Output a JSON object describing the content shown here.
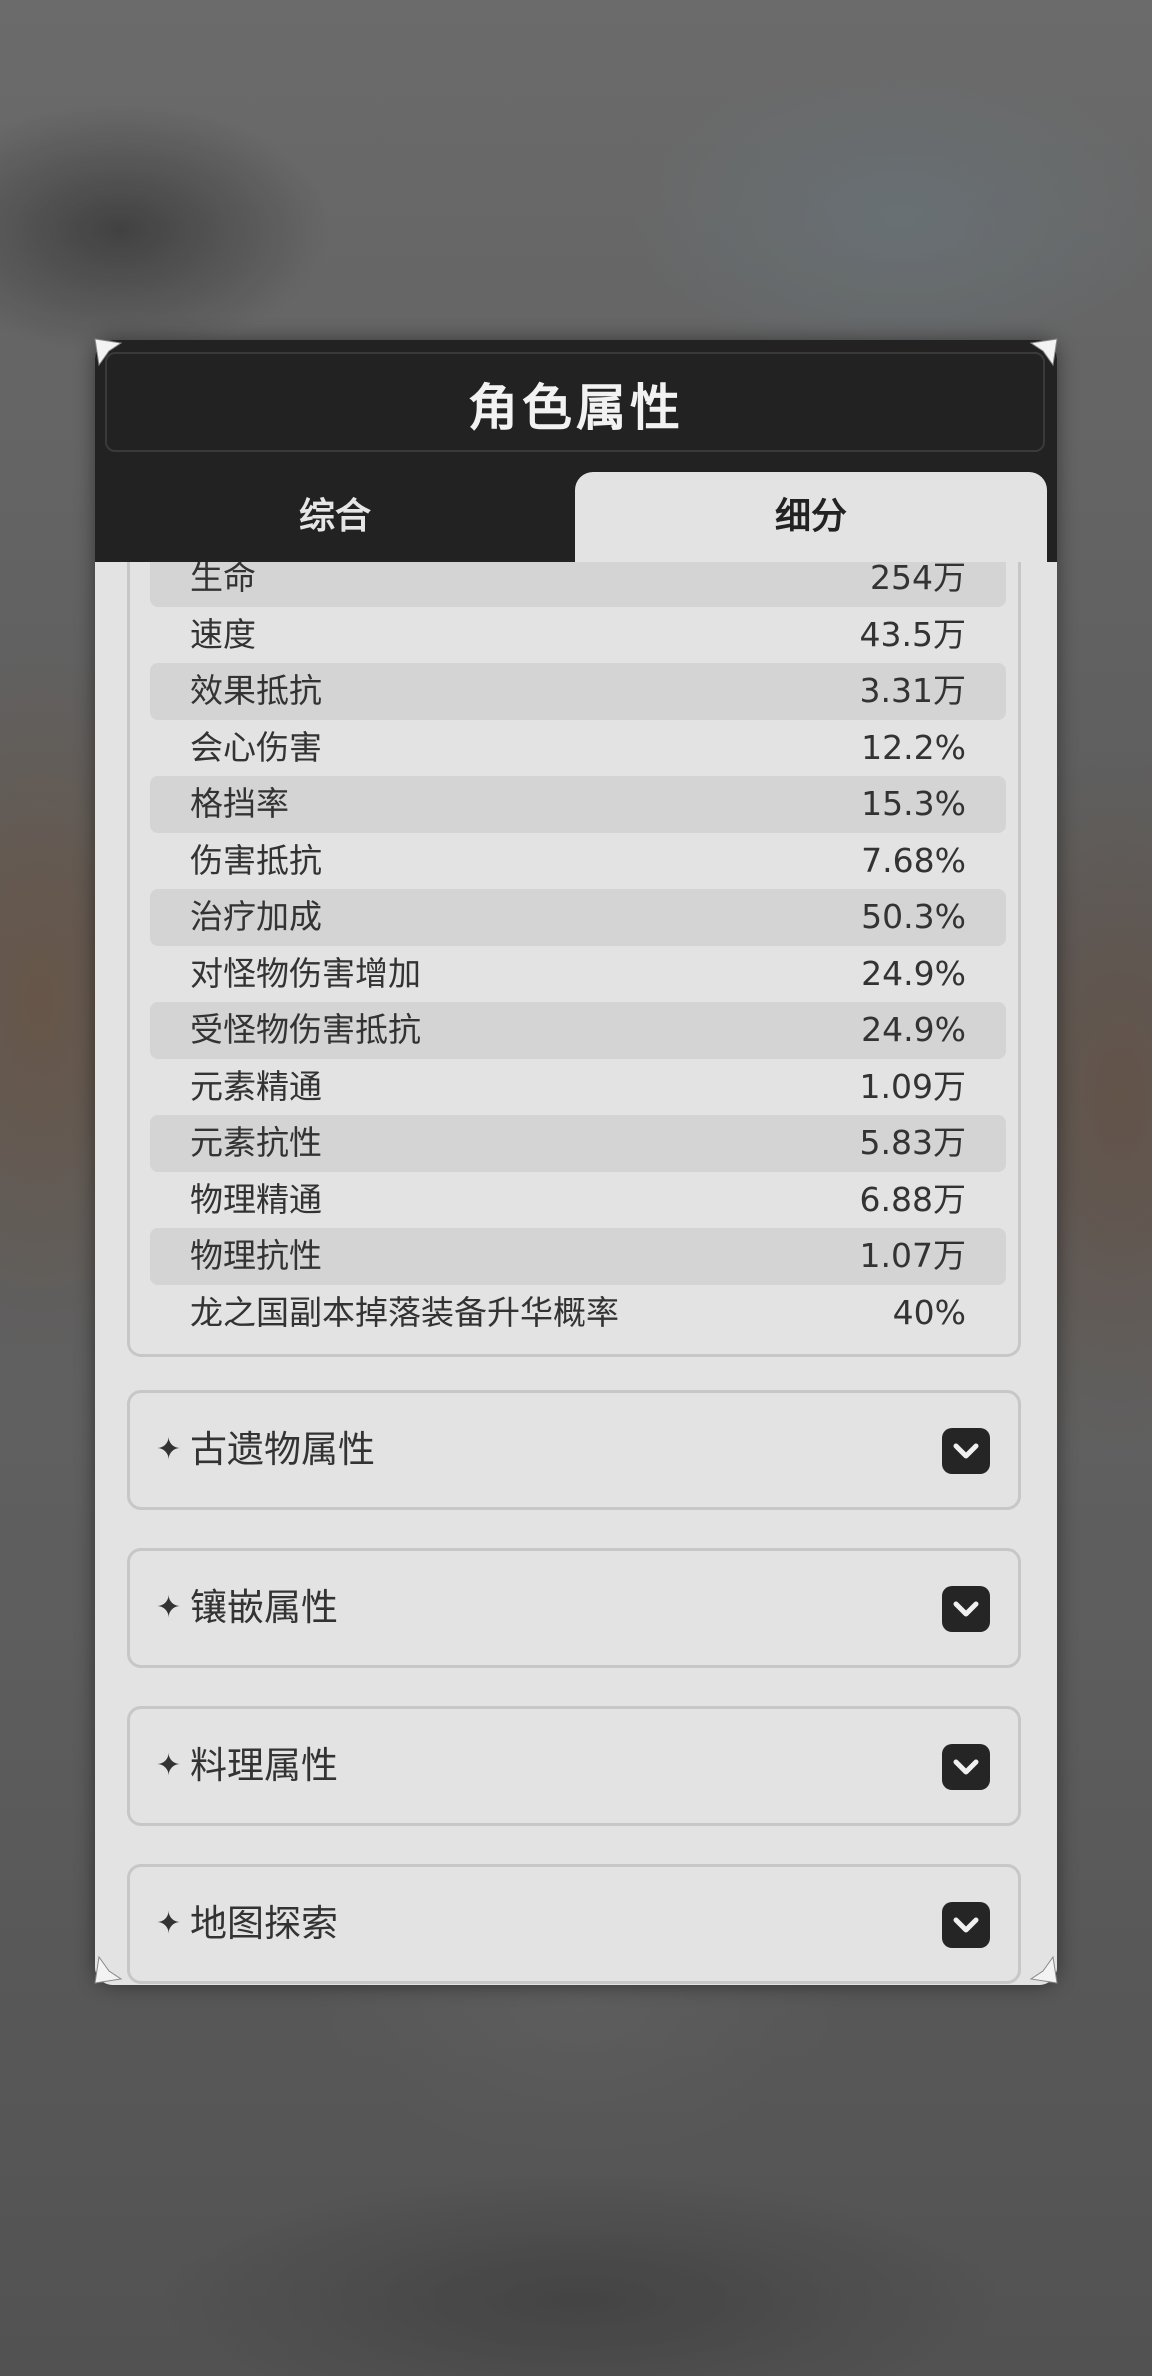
{
  "panel": {
    "title": "角色属性",
    "tabs": [
      {
        "label": "综合",
        "active": false
      },
      {
        "label": "细分",
        "active": true
      }
    ]
  },
  "stats": [
    {
      "name": "生命",
      "value": "254万"
    },
    {
      "name": "速度",
      "value": "43.5万"
    },
    {
      "name": "效果抵抗",
      "value": "3.31万"
    },
    {
      "name": "会心伤害",
      "value": "12.2%"
    },
    {
      "name": "格挡率",
      "value": "15.3%"
    },
    {
      "name": "伤害抵抗",
      "value": "7.68%"
    },
    {
      "name": "治疗加成",
      "value": "50.3%"
    },
    {
      "name": "对怪物伤害增加",
      "value": "24.9%"
    },
    {
      "name": "受怪物伤害抵抗",
      "value": "24.9%"
    },
    {
      "name": "元素精通",
      "value": "1.09万"
    },
    {
      "name": "元素抗性",
      "value": "5.83万"
    },
    {
      "name": "物理精通",
      "value": "6.88万"
    },
    {
      "name": "物理抗性",
      "value": "1.07万"
    },
    {
      "name": "龙之国副本掉落装备升华概率",
      "value": "40%"
    }
  ],
  "sections": [
    {
      "label": "古遗物属性",
      "icon": "chevron-down-icon"
    },
    {
      "label": "镶嵌属性",
      "icon": "chevron-down-icon"
    },
    {
      "label": "料理属性",
      "icon": "chevron-down-icon"
    },
    {
      "label": "地图探索",
      "icon": "chevron-down-icon"
    }
  ],
  "colors": {
    "header": "#222222",
    "panel": "#e3e3e3",
    "row_shade": "#d4d4d4",
    "text": "#333333"
  }
}
